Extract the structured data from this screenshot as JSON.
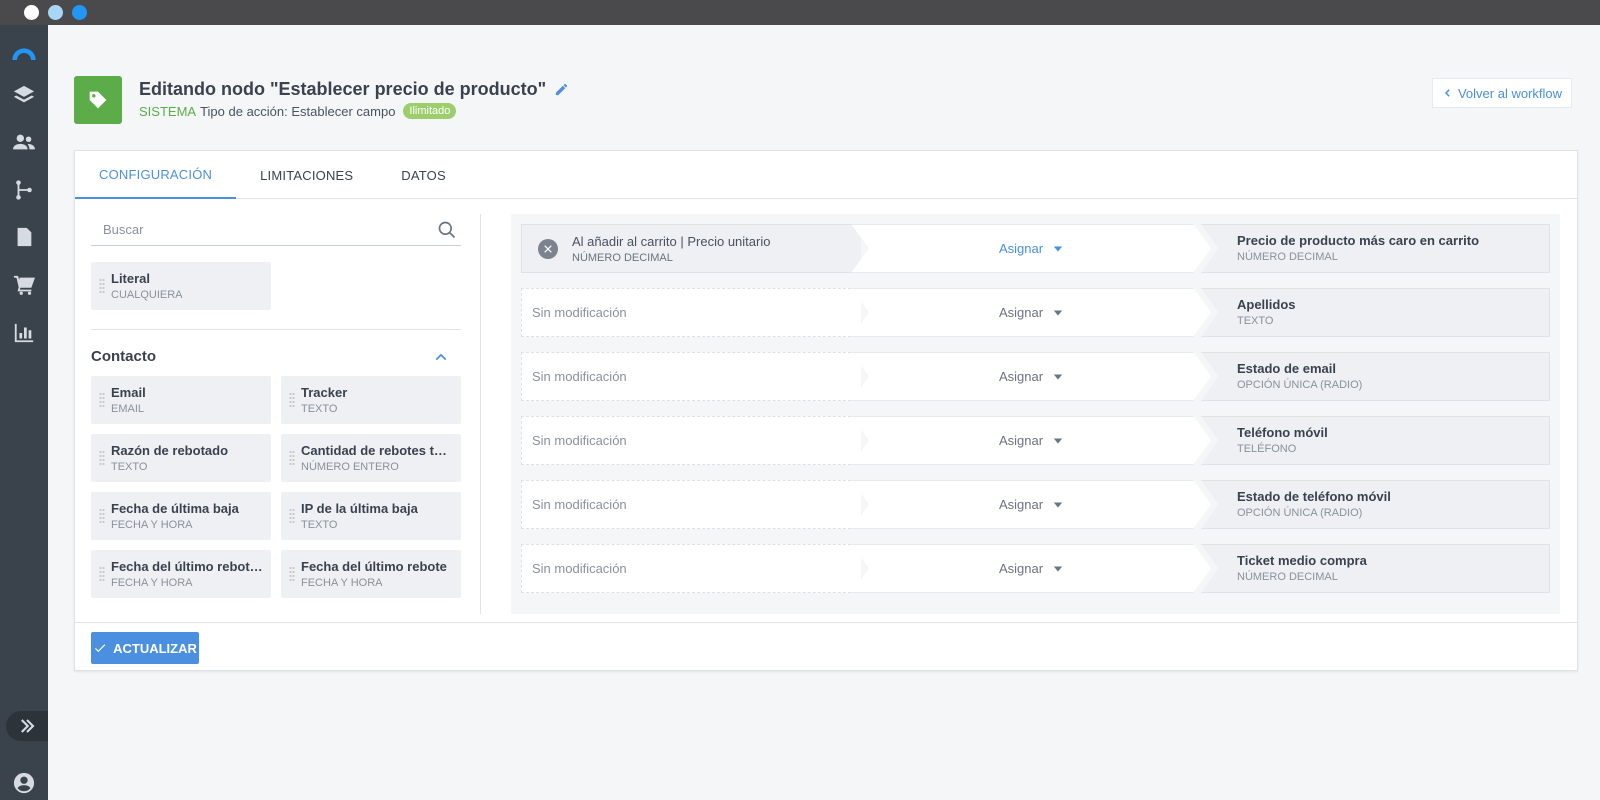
{
  "header": {
    "title": "Editando nodo \"Establecer precio de producto\"",
    "system_label": "SISTEMA",
    "action_type": "Tipo de acción: Establecer campo",
    "limit_badge": "Ilimitado",
    "back_label": "Volver al workflow"
  },
  "tabs": [
    {
      "label": "CONFIGURACIÓN",
      "active": true
    },
    {
      "label": "LIMITACIONES",
      "active": false
    },
    {
      "label": "DATOS",
      "active": false
    }
  ],
  "search": {
    "placeholder": "Buscar",
    "value": ""
  },
  "literal_field": {
    "name": "Literal",
    "type": "CUALQUIERA"
  },
  "section": {
    "title": "Contacto"
  },
  "fields": [
    {
      "name": "Email",
      "type": "EMAIL"
    },
    {
      "name": "Tracker",
      "type": "TEXTO"
    },
    {
      "name": "Razón de rebotado",
      "type": "TEXTO"
    },
    {
      "name": "Cantidad de rebotes te…",
      "type": "NÚMERO ENTERO"
    },
    {
      "name": "Fecha de última baja",
      "type": "FECHA Y HORA"
    },
    {
      "name": "IP de la última baja",
      "type": "TEXTO"
    },
    {
      "name": "Fecha del último rebot…",
      "type": "FECHA Y HORA"
    },
    {
      "name": "Fecha del último rebote",
      "type": "FECHA Y HORA"
    }
  ],
  "mappings": [
    {
      "source": "Al añadir al carrito | Precio unitario",
      "source_type": "NÚMERO DECIMAL",
      "operation": "Asignar",
      "target": "Precio de producto más caro en carrito",
      "target_type": "NÚMERO DECIMAL"
    },
    {
      "source": "Sin modificación",
      "source_type": "",
      "operation": "Asignar",
      "target": "Apellidos",
      "target_type": "TEXTO"
    },
    {
      "source": "Sin modificación",
      "source_type": "",
      "operation": "Asignar",
      "target": "Estado de email",
      "target_type": "OPCIÓN ÚNICA (RADIO)"
    },
    {
      "source": "Sin modificación",
      "source_type": "",
      "operation": "Asignar",
      "target": "Teléfono móvil",
      "target_type": "TELÉFONO"
    },
    {
      "source": "Sin modificación",
      "source_type": "",
      "operation": "Asignar",
      "target": "Estado de teléfono móvil",
      "target_type": "OPCIÓN ÚNICA (RADIO)"
    },
    {
      "source": "Sin modificación",
      "source_type": "",
      "operation": "Asignar",
      "target": "Ticket medio compra",
      "target_type": "NÚMERO DECIMAL"
    }
  ],
  "footer": {
    "update_label": "ACTUALIZAR"
  },
  "colors": {
    "accent": "#4a8fe0",
    "success": "#5cad4a",
    "sidebar": "#3a424c"
  }
}
